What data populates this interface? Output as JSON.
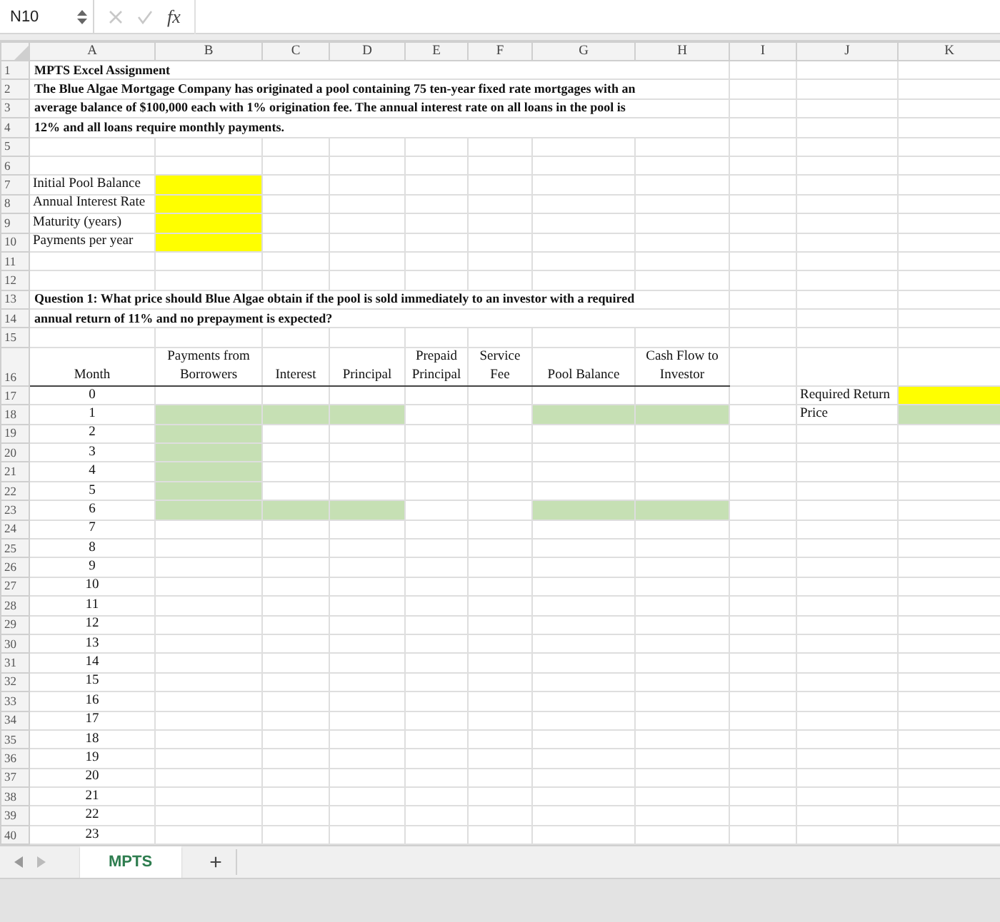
{
  "formula_bar": {
    "name_box": "N10",
    "fx_label": "fx"
  },
  "columns": [
    "A",
    "B",
    "C",
    "D",
    "E",
    "F",
    "G",
    "H",
    "I",
    "J",
    "K"
  ],
  "rows": [
    {
      "number": "1",
      "kind": "note",
      "text": "MPTS Excel Assignment"
    },
    {
      "number": "2",
      "kind": "note",
      "text": "The Blue Algae Mortgage Company has originated a pool containing 75 ten-year fixed rate mortgages with an"
    },
    {
      "number": "3",
      "kind": "note",
      "text": "average balance of $100,000 each with 1% origination fee.  The annual interest rate on all loans in the pool is"
    },
    {
      "number": "4",
      "kind": "note",
      "text": "12% and all loans require monthly payments."
    },
    {
      "number": "5",
      "kind": "plain"
    },
    {
      "number": "6",
      "kind": "plain"
    },
    {
      "number": "7",
      "kind": "plain",
      "cells": [
        {
          "text": "Initial Pool Balance",
          "kind": "label"
        },
        {
          "color": "#ffff00"
        }
      ]
    },
    {
      "number": "8",
      "kind": "plain",
      "cells": [
        {
          "text": "Annual Interest Rate",
          "kind": "label"
        },
        {
          "color": "#ffff00"
        }
      ]
    },
    {
      "number": "9",
      "kind": "plain",
      "cells": [
        {
          "text": "Maturity (years)",
          "kind": "label"
        },
        {
          "color": "#ffff00"
        }
      ]
    },
    {
      "number": "10",
      "kind": "plain",
      "cells": [
        {
          "text": "Payments per year",
          "kind": "label"
        },
        {
          "color": "#ffff00"
        }
      ]
    },
    {
      "number": "11",
      "kind": "plain"
    },
    {
      "number": "12",
      "kind": "plain"
    },
    {
      "number": "13",
      "kind": "note",
      "text": "Question 1:  What price should Blue Algae obtain if the pool is sold immediately to an investor with a required"
    },
    {
      "number": "14",
      "kind": "note",
      "text": "annual return of 11% and no prepayment is expected?"
    },
    {
      "number": "15",
      "kind": "plain"
    },
    {
      "number": "16",
      "kind": "header",
      "cells": [
        {
          "text": "Month",
          "kind": "value"
        },
        {
          "text": "Payments from\nBorrowers",
          "kind": "value"
        },
        {
          "text": "Interest",
          "kind": "value"
        },
        {
          "text": "Principal",
          "kind": "value"
        },
        {
          "text": "Prepaid\nPrincipal",
          "kind": "value"
        },
        {
          "text": "Service\nFee",
          "kind": "value"
        },
        {
          "text": "Pool Balance",
          "kind": "value"
        },
        {
          "text": "Cash Flow to\nInvestor",
          "kind": "value"
        }
      ]
    },
    {
      "number": "17",
      "kind": "plain",
      "cells": [
        {
          "text": "0",
          "kind": "value"
        },
        null,
        null,
        null,
        null,
        null,
        null,
        null,
        null,
        {
          "text": "Required Return",
          "kind": "label"
        },
        {
          "color": "#ffff00"
        }
      ]
    },
    {
      "number": "18",
      "kind": "plain",
      "cells": [
        {
          "text": "1",
          "kind": "value"
        },
        {
          "color": "#c6e0b4"
        },
        {
          "color": "#c6e0b4"
        },
        {
          "color": "#c6e0b4"
        },
        null,
        null,
        {
          "color": "#c6e0b4"
        },
        {
          "color": "#c6e0b4"
        },
        null,
        {
          "text": "Price",
          "kind": "label"
        },
        {
          "color": "#c6e0b4"
        }
      ]
    },
    {
      "number": "19",
      "kind": "plain",
      "cells": [
        {
          "text": "2",
          "kind": "value"
        },
        {
          "color": "#c6e0b4"
        }
      ]
    },
    {
      "number": "20",
      "kind": "plain",
      "cells": [
        {
          "text": "3",
          "kind": "value"
        },
        {
          "color": "#c6e0b4"
        }
      ]
    },
    {
      "number": "21",
      "kind": "plain",
      "cells": [
        {
          "text": "4",
          "kind": "value"
        },
        {
          "color": "#c6e0b4"
        }
      ]
    },
    {
      "number": "22",
      "kind": "plain",
      "cells": [
        {
          "text": "5",
          "kind": "value"
        },
        {
          "color": "#c6e0b4"
        }
      ]
    },
    {
      "number": "23",
      "kind": "plain",
      "cells": [
        {
          "text": "6",
          "kind": "value"
        },
        {
          "color": "#c6e0b4"
        },
        {
          "color": "#c6e0b4"
        },
        {
          "color": "#c6e0b4"
        },
        null,
        null,
        {
          "color": "#c6e0b4"
        },
        {
          "color": "#c6e0b4"
        }
      ]
    },
    {
      "number": "24",
      "kind": "plain",
      "cells": [
        {
          "text": "7",
          "kind": "value"
        }
      ]
    },
    {
      "number": "25",
      "kind": "plain",
      "cells": [
        {
          "text": "8",
          "kind": "value"
        }
      ]
    },
    {
      "number": "26",
      "kind": "plain",
      "cells": [
        {
          "text": "9",
          "kind": "value"
        }
      ]
    },
    {
      "number": "27",
      "kind": "plain",
      "cells": [
        {
          "text": "10",
          "kind": "value"
        }
      ]
    },
    {
      "number": "28",
      "kind": "plain",
      "cells": [
        {
          "text": "11",
          "kind": "value"
        }
      ]
    },
    {
      "number": "29",
      "kind": "plain",
      "cells": [
        {
          "text": "12",
          "kind": "value"
        }
      ]
    },
    {
      "number": "30",
      "kind": "plain",
      "cells": [
        {
          "text": "13",
          "kind": "value"
        }
      ]
    },
    {
      "number": "31",
      "kind": "plain",
      "cells": [
        {
          "text": "14",
          "kind": "value"
        }
      ]
    },
    {
      "number": "32",
      "kind": "plain",
      "cells": [
        {
          "text": "15",
          "kind": "value"
        }
      ]
    },
    {
      "number": "33",
      "kind": "plain",
      "cells": [
        {
          "text": "16",
          "kind": "value"
        }
      ]
    },
    {
      "number": "34",
      "kind": "plain",
      "cells": [
        {
          "text": "17",
          "kind": "value"
        }
      ]
    },
    {
      "number": "35",
      "kind": "plain",
      "cells": [
        {
          "text": "18",
          "kind": "value"
        }
      ]
    },
    {
      "number": "36",
      "kind": "plain",
      "cells": [
        {
          "text": "19",
          "kind": "value"
        }
      ]
    },
    {
      "number": "37",
      "kind": "plain",
      "cells": [
        {
          "text": "20",
          "kind": "value"
        }
      ]
    },
    {
      "number": "38",
      "kind": "plain",
      "cells": [
        {
          "text": "21",
          "kind": "value"
        }
      ]
    },
    {
      "number": "39",
      "kind": "plain",
      "cells": [
        {
          "text": "22",
          "kind": "value"
        }
      ]
    },
    {
      "number": "40",
      "kind": "plain",
      "cells": [
        {
          "text": "23",
          "kind": "value"
        }
      ]
    }
  ],
  "sheet_tabs": [
    {
      "label": "MPTS",
      "selected": true
    }
  ],
  "add_sheet": "+"
}
